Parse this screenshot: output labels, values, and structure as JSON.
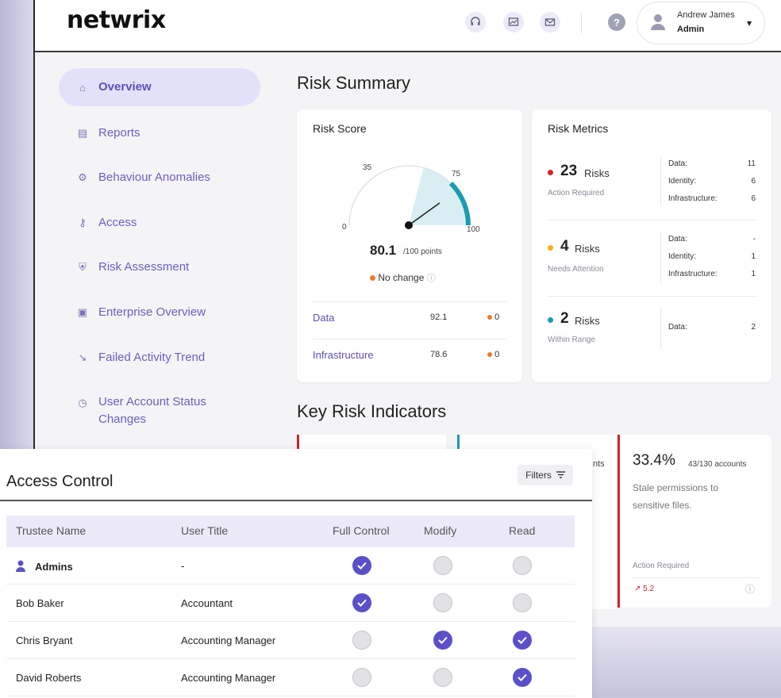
{
  "brand": {
    "logo": "netwrix"
  },
  "user": {
    "name": "Andrew James",
    "role": "Admin"
  },
  "sidebar": {
    "items": [
      {
        "label": "Overview",
        "icon": "home-icon",
        "active": true
      },
      {
        "label": "Reports",
        "icon": "report-icon"
      },
      {
        "label": "Behaviour Anomalies",
        "icon": "gear-icon"
      },
      {
        "label": "Access",
        "icon": "key-icon"
      },
      {
        "label": "Risk Assessment",
        "icon": "shield-icon"
      },
      {
        "label": "Enterprise Overview",
        "icon": "monitor-icon"
      },
      {
        "label": "Failed Activity Trend",
        "icon": "trend-down-icon"
      },
      {
        "label": "User Account Status Changes",
        "icon": "clock-icon"
      }
    ]
  },
  "main": {
    "title": "Risk Summary",
    "risk_score": {
      "title": "Risk Score",
      "gauge_ticks": [
        "0",
        "35",
        "75",
        "100"
      ],
      "gauge_value": 80.1,
      "score": "80.1",
      "score_unit": "/100 points",
      "change_text": "No change",
      "rows": [
        {
          "name": "Data",
          "value": "92.1",
          "change": "0"
        },
        {
          "name": "Infrastructure",
          "value": "78.6",
          "change": "0"
        }
      ]
    },
    "risk_metrics": {
      "title": "Risk Metrics",
      "items": [
        {
          "count": "23",
          "label": "Risks",
          "status": "Action Required",
          "color": "#d0232a",
          "breakdown": [
            {
              "k": "Data:",
              "v": "11"
            },
            {
              "k": "Identity:",
              "v": "6"
            },
            {
              "k": "Infrastructure:",
              "v": "6"
            }
          ]
        },
        {
          "count": "4",
          "label": "Risks",
          "status": "Needs Attention",
          "color": "#f2b418",
          "breakdown": [
            {
              "k": "Data:",
              "v": "-"
            },
            {
              "k": "Identity:",
              "v": "1"
            },
            {
              "k": "Infrastructure:",
              "v": "1"
            }
          ]
        },
        {
          "count": "2",
          "label": "Risks",
          "status": "Within Range",
          "color": "#1b9bb0",
          "breakdown": [
            {
              "k": "Data:",
              "v": "2"
            }
          ]
        }
      ]
    },
    "kri": {
      "title": "Key Risk Indicators",
      "partial_text": "nts",
      "card": {
        "pct": "33.4%",
        "ratio": "43/130 accounts",
        "desc": "Stale permissions to sensitive files.",
        "status": "Action Required",
        "trend": "5.2"
      }
    }
  },
  "access_control": {
    "title": "Access Control",
    "filters_label": "Filters",
    "columns": [
      "Trustee Name",
      "User Title",
      "Full Control",
      "Modify",
      "Read"
    ],
    "rows": [
      {
        "name": "Admins",
        "title": "-",
        "full": true,
        "modify": false,
        "read": false,
        "group": true
      },
      {
        "name": "Bob Baker",
        "title": "Accountant",
        "full": true,
        "modify": false,
        "read": false
      },
      {
        "name": "Chris Bryant",
        "title": "Accounting Manager",
        "full": false,
        "modify": true,
        "read": true
      },
      {
        "name": "David Roberts",
        "title": "Accounting Manager",
        "full": false,
        "modify": false,
        "read": true
      }
    ]
  },
  "colors": {
    "accent": "#5b50c9",
    "gauge": "#1b9bb0",
    "danger": "#d0232a",
    "orange": "#f07a2a"
  }
}
